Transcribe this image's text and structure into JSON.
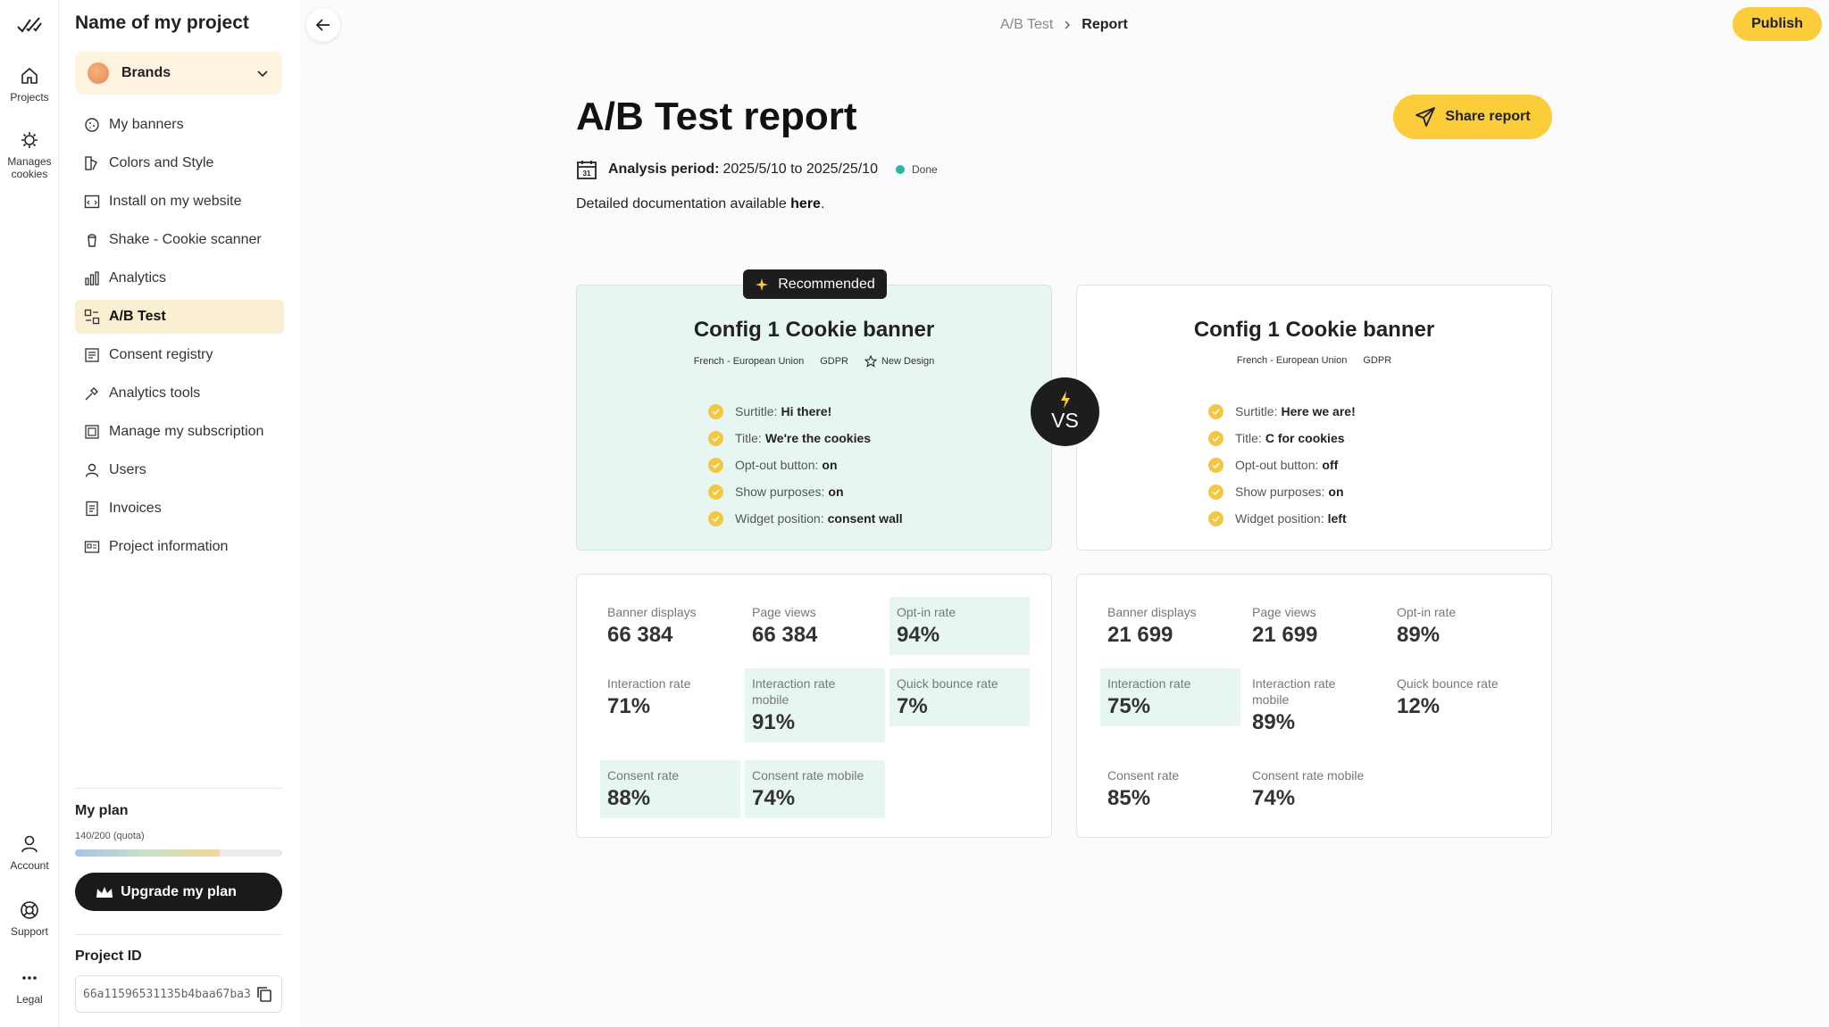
{
  "rail": {
    "items": [
      {
        "label": "Projects"
      },
      {
        "label": "Manages cookies"
      },
      {
        "label": "Account"
      },
      {
        "label": "Support"
      },
      {
        "label": "Legal"
      }
    ]
  },
  "sidebar": {
    "project_title": "Name of my project",
    "brand": "Brands",
    "nav": [
      {
        "label": "My banners",
        "icon": "cookie-icon"
      },
      {
        "label": "Colors and Style",
        "icon": "palette-icon"
      },
      {
        "label": "Install on my website",
        "icon": "code-window-icon"
      },
      {
        "label": "Shake - Cookie scanner",
        "icon": "shaker-icon"
      },
      {
        "label": "Analytics",
        "icon": "bar-chart-icon"
      },
      {
        "label": "A/B Test",
        "icon": "ab-test-icon"
      },
      {
        "label": "Consent registry",
        "icon": "registry-icon"
      },
      {
        "label": "Analytics tools",
        "icon": "tools-icon"
      },
      {
        "label": "Manage my subscription",
        "icon": "subscription-icon"
      },
      {
        "label": "Users",
        "icon": "user-icon"
      },
      {
        "label": "Invoices",
        "icon": "invoice-icon"
      },
      {
        "label": "Project information",
        "icon": "info-card-icon"
      }
    ],
    "active_nav": "A/B Test",
    "plan": {
      "title": "My plan",
      "quota": "140/200 (quota)",
      "used_fraction": 0.7,
      "upgrade_label": "Upgrade my plan"
    },
    "project_id": {
      "title": "Project ID",
      "value": "66a11596531135b4baa67ba3"
    }
  },
  "topbar": {
    "breadcrumb_parent": "A/B Test",
    "breadcrumb_current": "Report",
    "publish_label": "Publish"
  },
  "report": {
    "title": "A/B Test report",
    "share_label": "Share report",
    "period_label": "Analysis period:",
    "period_value": "2025/5/10 to 2025/25/10",
    "status": "Done",
    "docs_text": "Detailed documentation available ",
    "docs_link": "here",
    "docs_end": ".",
    "recommended_label": "Recommended",
    "vs_label": "VS"
  },
  "configs": [
    {
      "title": "Config 1 Cookie banner",
      "tags": [
        "French - European Union",
        "GDPR"
      ],
      "extra_tag": "New Design",
      "rows": [
        {
          "label": "Surtitle:",
          "value": "Hi there!"
        },
        {
          "label": "Title:",
          "value": "We're the cookies"
        },
        {
          "label": "Opt-out button:",
          "value": "on"
        },
        {
          "label": "Show purposes:",
          "value": "on"
        },
        {
          "label": "Widget position:",
          "value": "consent wall"
        }
      ],
      "metrics": [
        {
          "label": "Banner displays",
          "value": "66 384"
        },
        {
          "label": "Page views",
          "value": "66 384"
        },
        {
          "label": "Opt-in rate",
          "value": "94%"
        },
        {
          "label": "Interaction rate",
          "value": "71%"
        },
        {
          "label": "Interaction rate mobile",
          "value": "91%"
        },
        {
          "label": "Quick bounce rate",
          "value": "7%"
        },
        {
          "label": "Consent rate",
          "value": "88%"
        },
        {
          "label": "Consent rate mobile",
          "value": "74%"
        }
      ]
    },
    {
      "title": "Config 1 Cookie banner",
      "tags": [
        "French - European Union",
        "GDPR"
      ],
      "rows": [
        {
          "label": "Surtitle:",
          "value": "Here we are!"
        },
        {
          "label": "Title:",
          "value": "C for cookies"
        },
        {
          "label": "Opt-out button:",
          "value": "off"
        },
        {
          "label": "Show purposes:",
          "value": "on"
        },
        {
          "label": "Widget position:",
          "value": "left"
        }
      ],
      "metrics": [
        {
          "label": "Banner displays",
          "value": "21 699"
        },
        {
          "label": "Page views",
          "value": "21 699"
        },
        {
          "label": "Opt-in rate",
          "value": "89%"
        },
        {
          "label": "Interaction rate",
          "value": "75%"
        },
        {
          "label": "Interaction rate mobile",
          "value": "89%"
        },
        {
          "label": "Quick bounce rate",
          "value": "12%"
        },
        {
          "label": "Consent rate",
          "value": "85%"
        },
        {
          "label": "Consent rate mobile",
          "value": "74%"
        }
      ]
    }
  ],
  "colors": {
    "accent": "#fbcd3b",
    "highlight": "#e8f6f2",
    "active_nav": "#fbefd3",
    "dark": "#1d1d1d",
    "status_done": "#2bb5a1"
  }
}
